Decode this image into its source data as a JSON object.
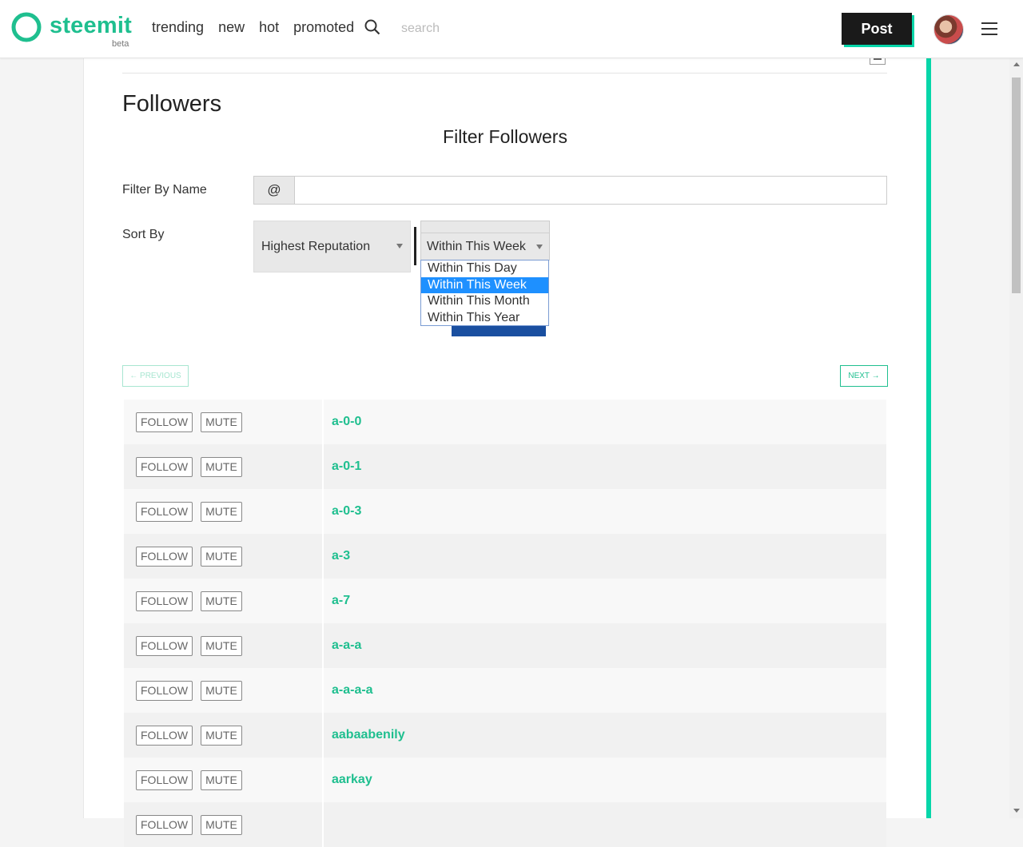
{
  "brand": {
    "name": "steemit",
    "beta": "beta",
    "color": "#1fbf8f"
  },
  "nav": [
    "trending",
    "new",
    "hot",
    "promoted"
  ],
  "search": {
    "placeholder": "search"
  },
  "header": {
    "post_label": "Post"
  },
  "page": {
    "title": "Followers",
    "filter_title": "Filter Followers"
  },
  "filter": {
    "name_label": "Filter By Name",
    "at_symbol": "@",
    "name_value": "",
    "sort_label": "Sort By",
    "sort_value": "Highest Reputation",
    "period_value": "Within This Week",
    "period_options": [
      "Within This Day",
      "Within This Week",
      "Within This Month",
      "Within This Year"
    ],
    "period_selected_index": 1
  },
  "pagination": {
    "previous": "← PREVIOUS",
    "next": "NEXT →"
  },
  "row_actions": {
    "follow": "FOLLOW",
    "mute": "MUTE"
  },
  "followers": [
    "a-0-0",
    "a-0-1",
    "a-0-3",
    "a-3",
    "a-7",
    "a-a-a",
    "a-a-a-a",
    "aabaabenily",
    "aarkay",
    ""
  ]
}
